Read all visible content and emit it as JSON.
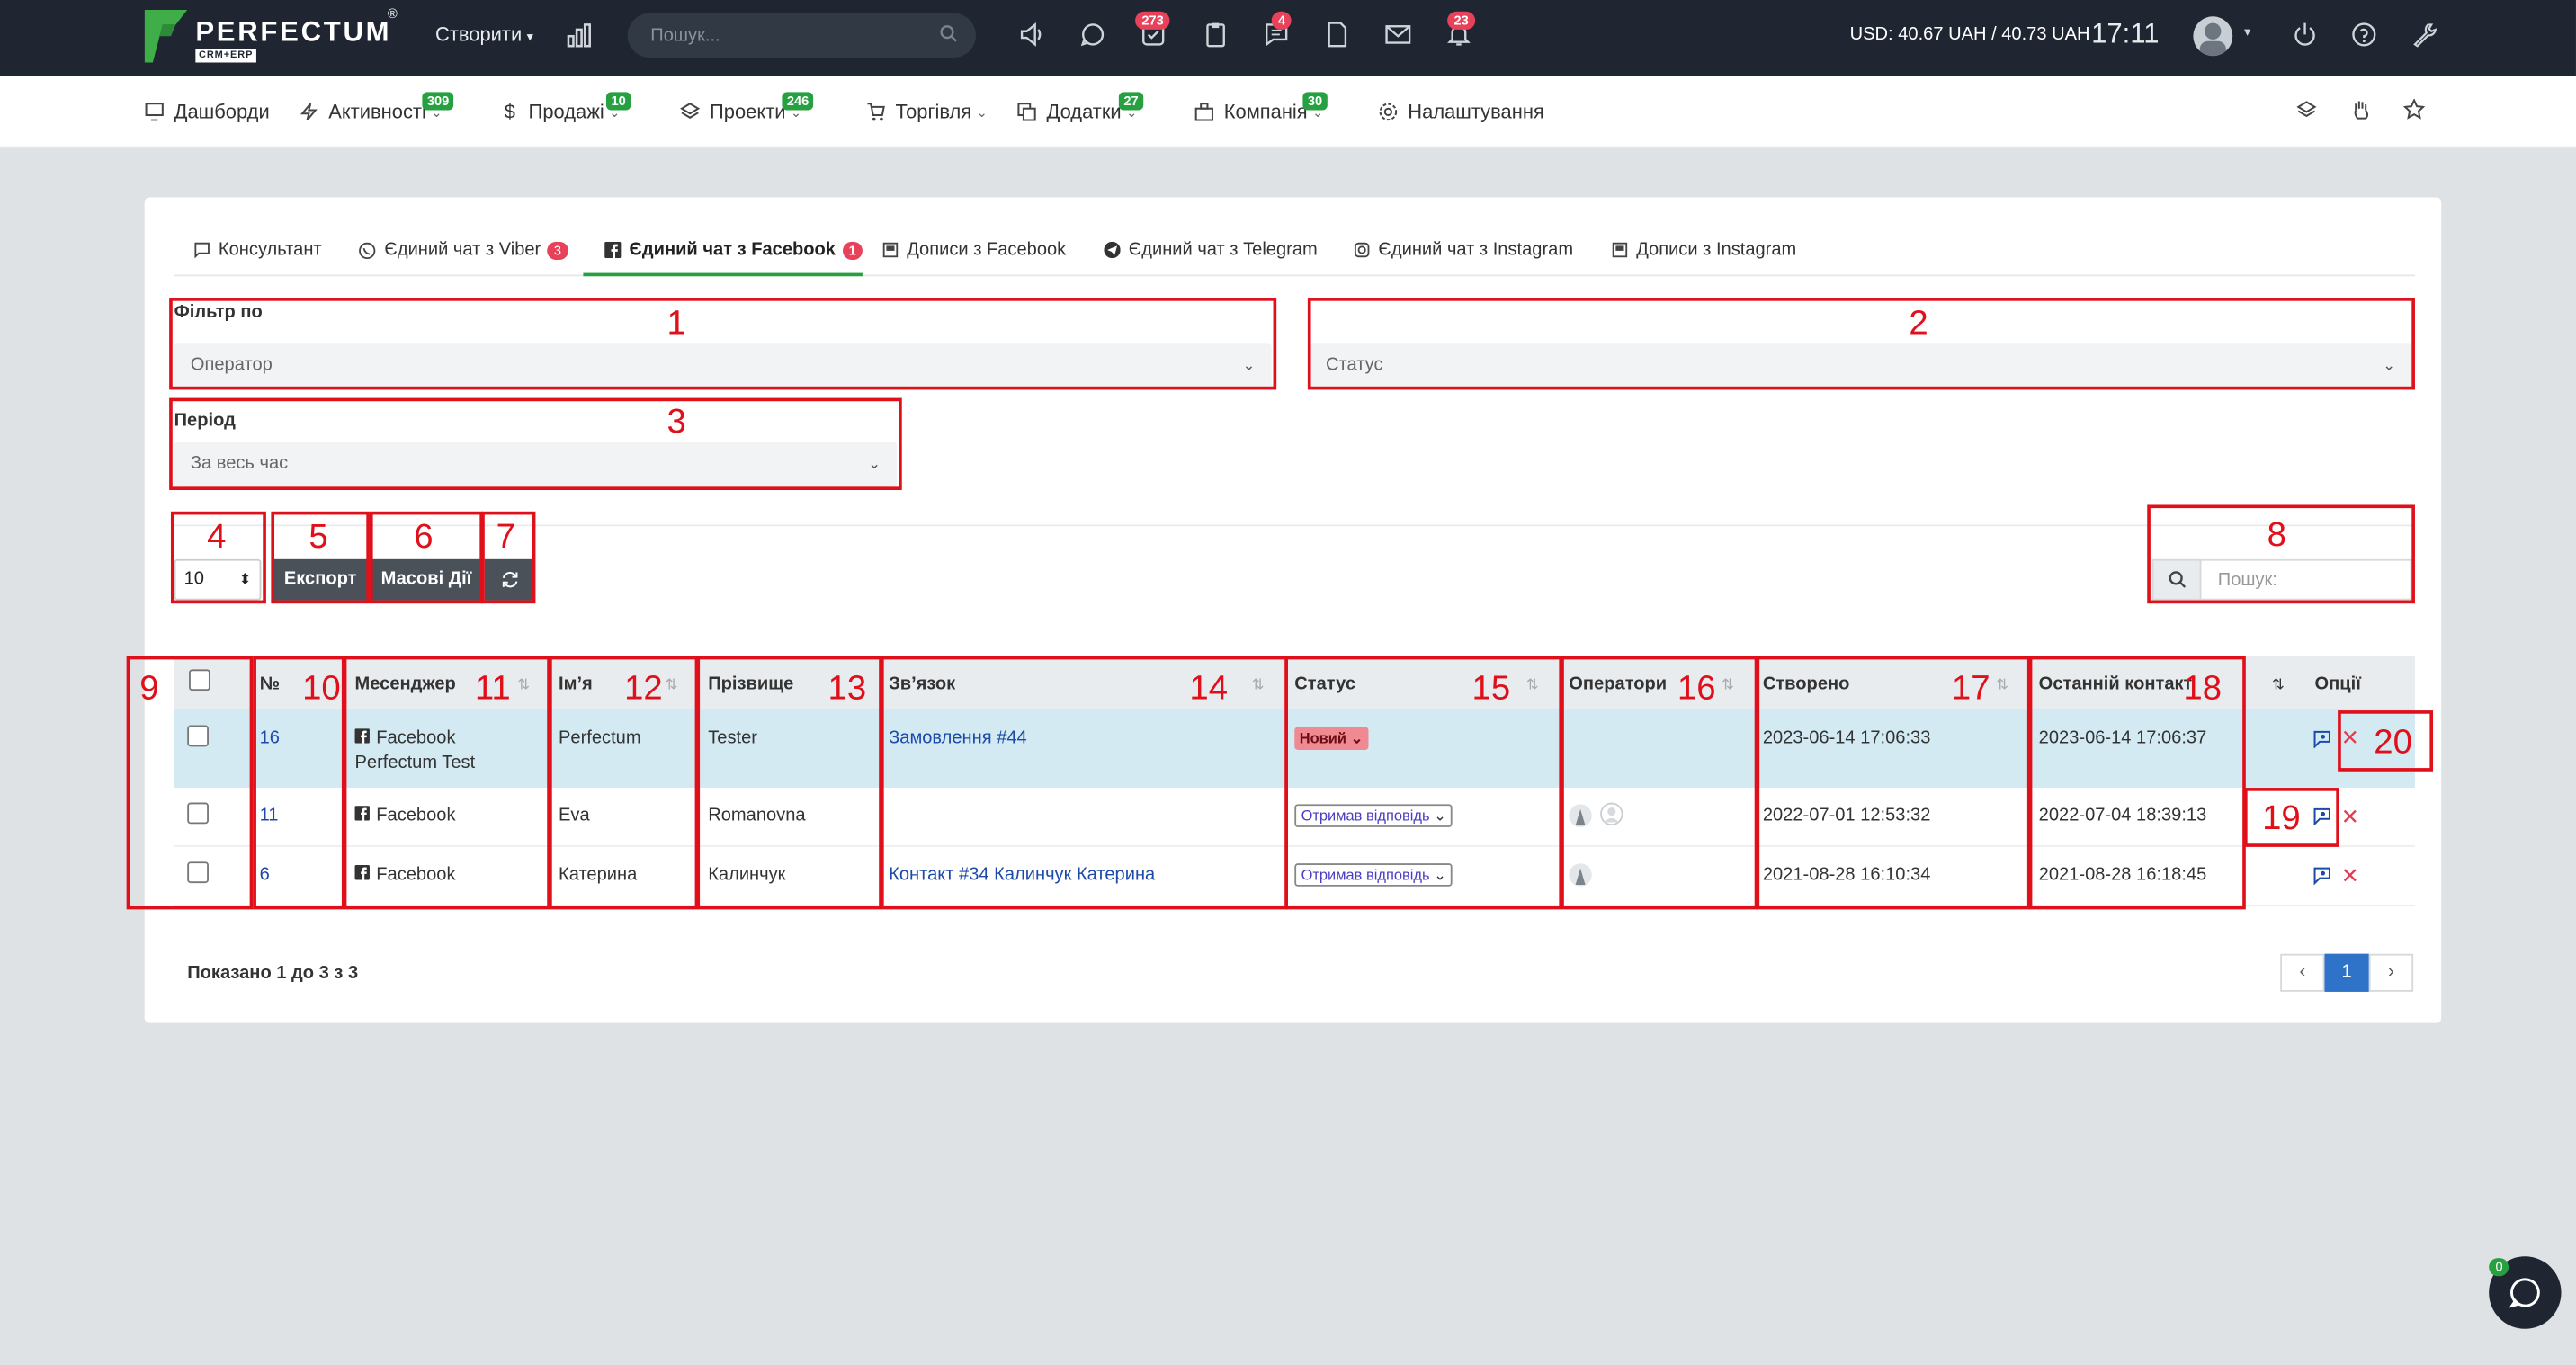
{
  "app": {
    "logo_text": "PERFECTUM",
    "logo_sub": "CRM+ERP",
    "logo_reg": "®"
  },
  "topbar": {
    "create_label": "Створити",
    "search_placeholder": "Пошук...",
    "badges": {
      "tasks": "273",
      "chats": "4",
      "notifications": "23"
    },
    "currency": "USD: 40.67 UAH / 40.73 UAH",
    "time": "17:11"
  },
  "nav": {
    "items": [
      {
        "label": "Дашборди",
        "icon": "monitor-icon"
      },
      {
        "label": "Активності",
        "badge": "309",
        "icon": "bolt-icon"
      },
      {
        "label": "Продажі",
        "badge": "10",
        "icon": "dollar-icon"
      },
      {
        "label": "Проекти",
        "badge": "246",
        "icon": "layers-icon"
      },
      {
        "label": "Торгівля",
        "icon": "cart-icon"
      },
      {
        "label": "Додатки",
        "badge": "27",
        "icon": "copy-icon"
      },
      {
        "label": "Компанія",
        "badge": "30",
        "icon": "building-icon"
      },
      {
        "label": "Налаштування",
        "icon": "gear-icon"
      }
    ]
  },
  "tabs": [
    {
      "label": "Консультант"
    },
    {
      "label": "Єдиний чат з Viber",
      "count": "3"
    },
    {
      "label": "Єдиний чат з Facebook",
      "count": "1"
    },
    {
      "label": "Дописи з Facebook"
    },
    {
      "label": "Єдиний чат з Telegram"
    },
    {
      "label": "Єдиний чат з Instagram"
    },
    {
      "label": "Дописи з Instagram"
    }
  ],
  "filters": {
    "filter_label": "Фільтр по",
    "operator_placeholder": "Оператор",
    "status_placeholder": "Статус",
    "period_label": "Період",
    "period_value": "За весь час"
  },
  "toolbar": {
    "per_page": "10",
    "export_label": "Експорт",
    "mass_label": "Масові Дії",
    "search_placeholder": "Пошук:"
  },
  "table": {
    "headers": {
      "num": "№",
      "messenger": "Месенджер",
      "name": "Ім’я",
      "surname": "Прізвище",
      "relation": "Зв’язок",
      "status": "Статус",
      "operators": "Оператори",
      "created": "Створено",
      "last_contact": "Останній контакт",
      "options": "Опції"
    },
    "rows": [
      {
        "num": "16",
        "messenger": "Facebook",
        "messenger_sub": "Perfectum Test",
        "name": "Perfectum",
        "surname": "Tester",
        "relation": "Замовлення #44",
        "status": "Новий",
        "created": "2023-06-14 17:06:33",
        "last_contact": "2023-06-14 17:06:37"
      },
      {
        "num": "11",
        "messenger": "Facebook",
        "messenger_sub": "",
        "name": "Eva",
        "surname": "Romanovna",
        "relation": "",
        "status": "Отримав відповідь",
        "created": "2022-07-01 12:53:32",
        "last_contact": "2022-07-04 18:39:13"
      },
      {
        "num": "6",
        "messenger": "Facebook",
        "messenger_sub": "",
        "name": "Катерина",
        "surname": "Калинчук",
        "relation": "Контакт #34 Калинчук Катерина",
        "status": "Отримав відповідь",
        "created": "2021-08-28 16:10:34",
        "last_contact": "2021-08-28 16:18:45"
      }
    ]
  },
  "footer": {
    "showing": "Показано 1 до 3 з 3",
    "page": "1",
    "prev": "‹",
    "next": "›"
  },
  "chat_widget": {
    "badge": "0"
  },
  "annotations": [
    "1",
    "2",
    "3",
    "4",
    "5",
    "6",
    "7",
    "8",
    "9",
    "10",
    "11",
    "12",
    "13",
    "14",
    "15",
    "16",
    "17",
    "18",
    "19",
    "20"
  ],
  "colors": {
    "topbar": "#1f2631",
    "accent_green": "#26a041",
    "badge_red": "#e8425b",
    "annotation_red": "#e0101b",
    "row_highlight": "#d3eaf3",
    "link": "#1c4aa8"
  }
}
